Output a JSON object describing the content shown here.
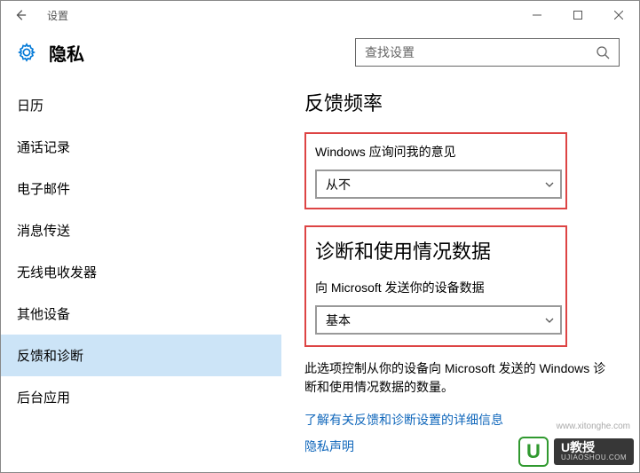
{
  "window": {
    "title": "设置"
  },
  "header": {
    "title": "隐私",
    "search_placeholder": "查找设置"
  },
  "sidebar": {
    "items": [
      {
        "label": "日历"
      },
      {
        "label": "通话记录"
      },
      {
        "label": "电子邮件"
      },
      {
        "label": "消息传送"
      },
      {
        "label": "无线电收发器"
      },
      {
        "label": "其他设备"
      },
      {
        "label": "反馈和诊断"
      },
      {
        "label": "后台应用"
      }
    ],
    "active_index": 6
  },
  "content": {
    "feedback": {
      "heading": "反馈频率",
      "label": "Windows 应询问我的意见",
      "select_value": "从不"
    },
    "diagnostics": {
      "heading": "诊断和使用情况数据",
      "label": "向 Microsoft 发送你的设备数据",
      "select_value": "基本",
      "desc": "此选项控制从你的设备向 Microsoft 发送的 Windows 诊断和使用情况数据的数量。",
      "link1": "了解有关反馈和诊断设置的详细信息",
      "link2": "隐私声明"
    }
  },
  "watermark": {
    "badge": "U",
    "text_big": "U教授",
    "text_small": "UJIAOSHOU.COM",
    "sub": "www.xitonghe.com"
  }
}
